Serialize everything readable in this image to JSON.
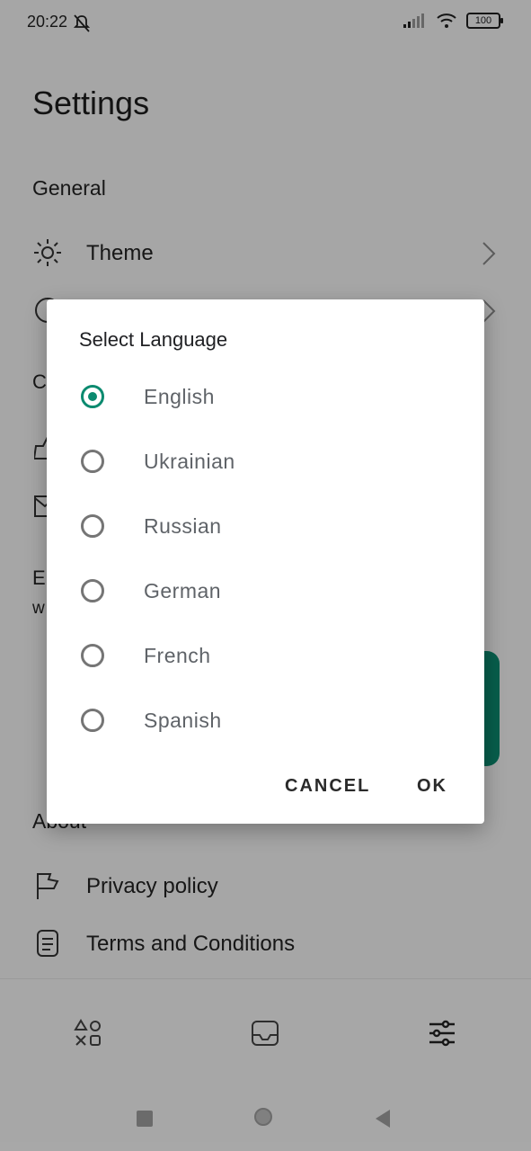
{
  "status_bar": {
    "time": "20:22",
    "battery": "100"
  },
  "settings": {
    "title": "Settings",
    "sections": {
      "general": "General",
      "about": "About"
    },
    "rows": {
      "theme": "Theme",
      "privacy_policy": "Privacy policy",
      "terms": "Terms and Conditions"
    },
    "partial": {
      "c": "C",
      "e": "E",
      "w": "w"
    }
  },
  "dialog": {
    "title": "Select Language",
    "options": [
      {
        "label": "English",
        "selected": true
      },
      {
        "label": "Ukrainian",
        "selected": false
      },
      {
        "label": "Russian",
        "selected": false
      },
      {
        "label": "German",
        "selected": false
      },
      {
        "label": "French",
        "selected": false
      },
      {
        "label": "Spanish",
        "selected": false
      }
    ],
    "cancel": "CANCEL",
    "ok": "OK"
  },
  "colors": {
    "accent": "#0b8a6f",
    "scrim": "rgba(0,0,0,0.32)"
  },
  "icons": {
    "theme": "sun-icon",
    "language": "globe-icon",
    "chevron": "chevron-right-icon",
    "privacy": "flag-icon",
    "terms": "document-icon",
    "nav": [
      "shapes-icon",
      "inbox-icon",
      "sliders-icon"
    ],
    "system_nav": [
      "recents-icon",
      "home-icon",
      "back-icon"
    ]
  }
}
